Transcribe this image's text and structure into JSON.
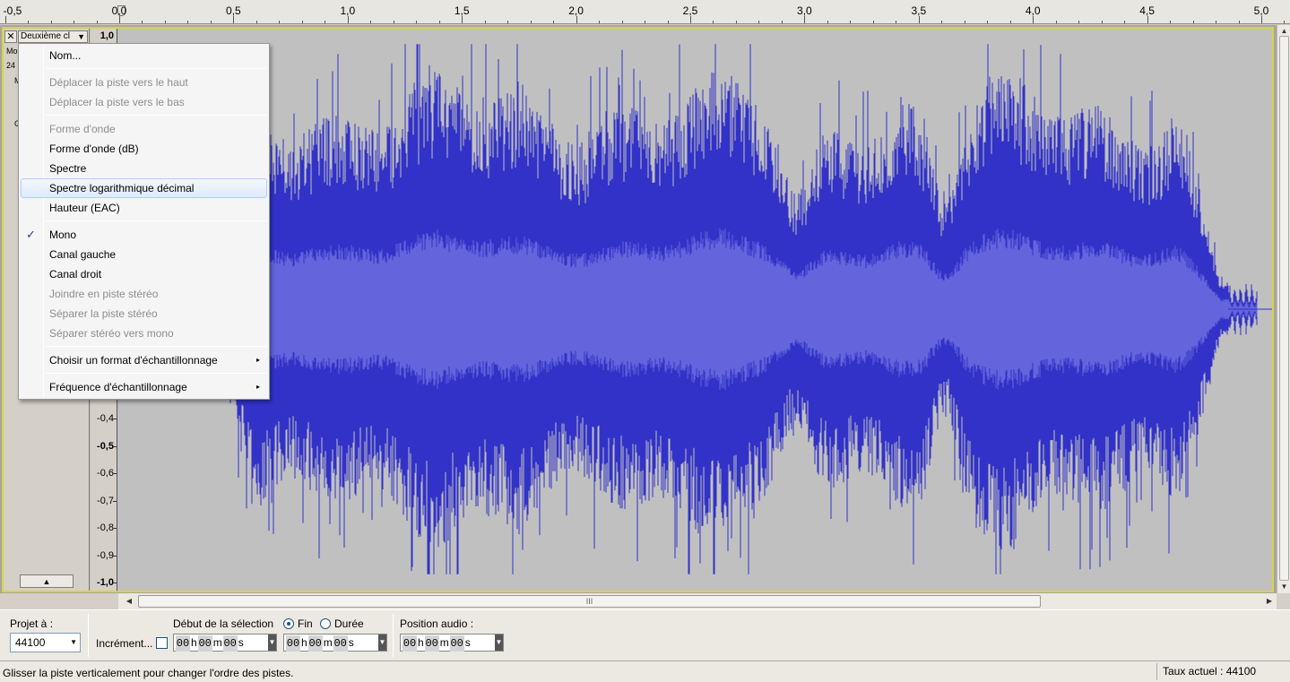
{
  "timeline": {
    "ticks": [
      "-0,5",
      "0,0",
      "0,5",
      "1,0",
      "1,5",
      "2,0",
      "2,5",
      "3,0",
      "3,5",
      "4,0",
      "4,5",
      "5,0"
    ]
  },
  "track": {
    "close_label": "✕",
    "name": "Deuxième cl",
    "name_arrow": "▼",
    "info_line1": "Mo",
    "info_line2": "24",
    "info_line3": "M",
    "info_line4": "G",
    "collapse_icon": "▲"
  },
  "amplitude_ruler": {
    "top_label": "1,0",
    "labels": [
      "-0,4",
      "-0,5",
      "-0,6",
      "-0,7",
      "-0,8",
      "-0,9",
      "-1,0"
    ]
  },
  "waveform": {
    "color": "#3232c8",
    "rms_color": "#6464dc",
    "background": "#c0c0c0"
  },
  "context_menu": {
    "items": [
      {
        "label": "Nom...",
        "enabled": true
      },
      {
        "label": "Déplacer la piste vers le haut",
        "enabled": false
      },
      {
        "label": "Déplacer la piste vers le bas",
        "enabled": false
      },
      {
        "label": "Forme d'onde",
        "enabled": false
      },
      {
        "label": "Forme d'onde (dB)",
        "enabled": true
      },
      {
        "label": "Spectre",
        "enabled": true
      },
      {
        "label": "Spectre logarithmique décimal",
        "enabled": true,
        "highlighted": true
      },
      {
        "label": "Hauteur (EAC)",
        "enabled": true
      },
      {
        "label": "Mono",
        "enabled": true,
        "checked": true,
        "check_mark": "✓"
      },
      {
        "label": "Canal gauche",
        "enabled": true
      },
      {
        "label": "Canal droit",
        "enabled": true
      },
      {
        "label": "Joindre en piste stéréo",
        "enabled": false
      },
      {
        "label": "Séparer la piste stéréo",
        "enabled": false
      },
      {
        "label": "Séparer stéréo vers mono",
        "enabled": false
      },
      {
        "label": "Choisir un format d'échantillonnage",
        "enabled": true,
        "submenu": true,
        "submenu_arrow": "▸"
      },
      {
        "label": "Fréquence d'échantillonnage",
        "enabled": true,
        "submenu": true,
        "submenu_arrow": "▸"
      }
    ]
  },
  "scrollbars": {
    "up": "▲",
    "down": "▼",
    "left": "◀",
    "right": "▶",
    "grip": "III"
  },
  "selection_bar": {
    "project_rate_label": "Projet à :",
    "project_rate_value": "44100",
    "dropdown_arrow": "▼",
    "snap_label": "Incrément...",
    "selection_start_label": "Début de la sélection",
    "end_label": "Fin",
    "length_label": "Durée",
    "audio_position_label": "Position audio :",
    "end_selected": true,
    "time_start": {
      "h": "00",
      "m": "00",
      "s": "00"
    },
    "time_end": {
      "h": "00",
      "m": "00",
      "s": "00"
    },
    "time_position": {
      "h": "00",
      "m": "00",
      "s": "00"
    },
    "unit_h": "h",
    "unit_m": "m",
    "unit_s": "s"
  },
  "status_bar": {
    "message": "Glisser la piste verticalement pour changer l'ordre des pistes.",
    "rate_text": "Taux actuel : 44100"
  }
}
